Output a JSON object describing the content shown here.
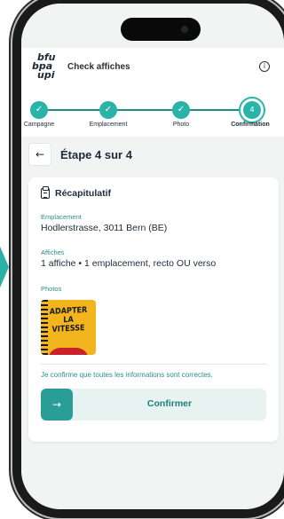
{
  "app": {
    "logo_lines": [
      "bfu",
      "bpa",
      "upi"
    ],
    "title": "Check affiches",
    "info_icon": "info-icon"
  },
  "stepper": {
    "steps": [
      {
        "label": "Campagne",
        "state": "done",
        "icon": "check-icon",
        "glyph": "✓"
      },
      {
        "label": "Emplacement",
        "state": "done",
        "icon": "check-icon",
        "glyph": "✓"
      },
      {
        "label": "Photo",
        "state": "done",
        "icon": "check-icon",
        "glyph": "✓"
      },
      {
        "label": "Confirmation",
        "state": "current",
        "glyph": "4"
      }
    ]
  },
  "header": {
    "back_icon": "back-arrow-icon",
    "back_glyph": "←",
    "title": "Étape 4 sur 4"
  },
  "summary": {
    "title": "Récapitulatif",
    "icon": "clipboard-icon",
    "location_label": "Emplacement",
    "location_value": "Hodlerstrasse, 3011 Bern (BE)",
    "posters_label": "Affiches",
    "posters_value": "1 affiche • 1 emplacement, recto OU verso",
    "photos_label": "Photos",
    "photo_caption": "ADAPTER LA VITESSE",
    "confirm_statement": "Je confirme que toutes les informations sont correctes.",
    "confirm_button": "Confirmer",
    "confirm_glyph": "→"
  },
  "colors": {
    "accent": "#29b3a9",
    "accent_dark": "#1e7e78",
    "label": "#2a8f89",
    "text": "#1d2a3a",
    "button_bg": "#e7f3f1"
  }
}
